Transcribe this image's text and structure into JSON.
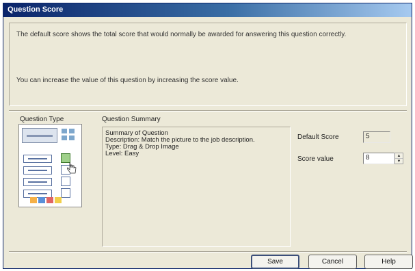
{
  "window": {
    "title": "Question Score"
  },
  "info": {
    "line1": "The default score shows the total score that would normally be awarded for answering this question correctly.",
    "line2": "You can increase the value of this question by increasing the score value."
  },
  "question_type": {
    "label": "Question Type"
  },
  "question_summary": {
    "label": "Question Summary",
    "lines": [
      "Summary of Question",
      "Description:  Match the picture to the job description.",
      "Type: Drag & Drop Image",
      "Level: Easy"
    ]
  },
  "fields": {
    "default_score": {
      "label": "Default Score",
      "value": "5"
    },
    "score_value": {
      "label": "Score value",
      "value": "8"
    }
  },
  "buttons": {
    "save": "Save",
    "cancel": "Cancel",
    "help": "Help"
  },
  "colors": {
    "titlebar": "#0a246a",
    "dialog_bg": "#ece9d8"
  }
}
